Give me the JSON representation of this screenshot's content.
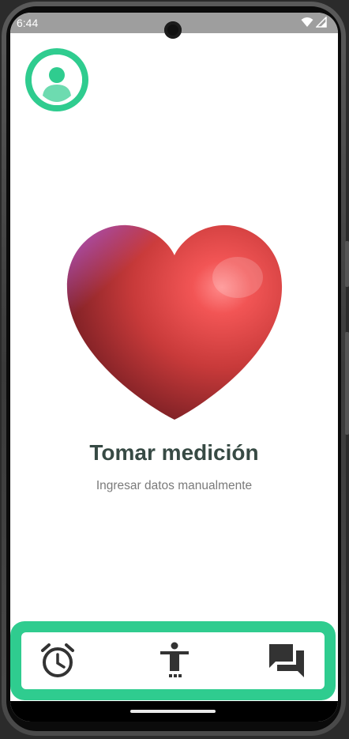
{
  "status_bar": {
    "time": "6:44",
    "icons": [
      "camera-cutout",
      "wifi-icon",
      "signal-icon"
    ]
  },
  "profile": {
    "icon": "person-icon",
    "accent_color": "#2fcc8f"
  },
  "main": {
    "heart_icon": "heart-icon",
    "title": "Tomar medición",
    "subtitle": "Ingresar datos manualmente"
  },
  "bottom_nav": {
    "items": [
      {
        "icon": "alarm-clock-icon"
      },
      {
        "icon": "accessibility-icon"
      },
      {
        "icon": "chat-icon"
      }
    ]
  },
  "colors": {
    "accent": "#2fcc8f",
    "title": "#374a44",
    "subtitle": "#7a7a7a",
    "heart": "#e04848"
  }
}
